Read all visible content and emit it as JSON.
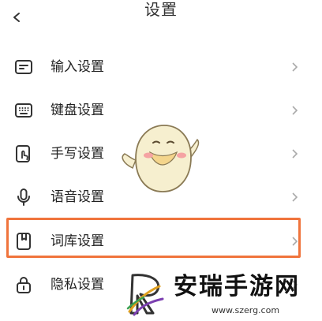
{
  "header": {
    "title": "设置"
  },
  "settings": {
    "items": [
      {
        "label": "输入设置",
        "icon": "input-icon"
      },
      {
        "label": "键盘设置",
        "icon": "keyboard-icon"
      },
      {
        "label": "手写设置",
        "icon": "handwriting-icon"
      },
      {
        "label": "语音设置",
        "icon": "microphone-icon"
      },
      {
        "label": "词库设置",
        "icon": "lexicon-icon"
      },
      {
        "label": "隐私设置",
        "icon": "lock-icon"
      }
    ],
    "highlight_color": "#f0743c"
  },
  "watermark": {
    "text": "安瑞手游网",
    "url": "www.szerg.com"
  }
}
